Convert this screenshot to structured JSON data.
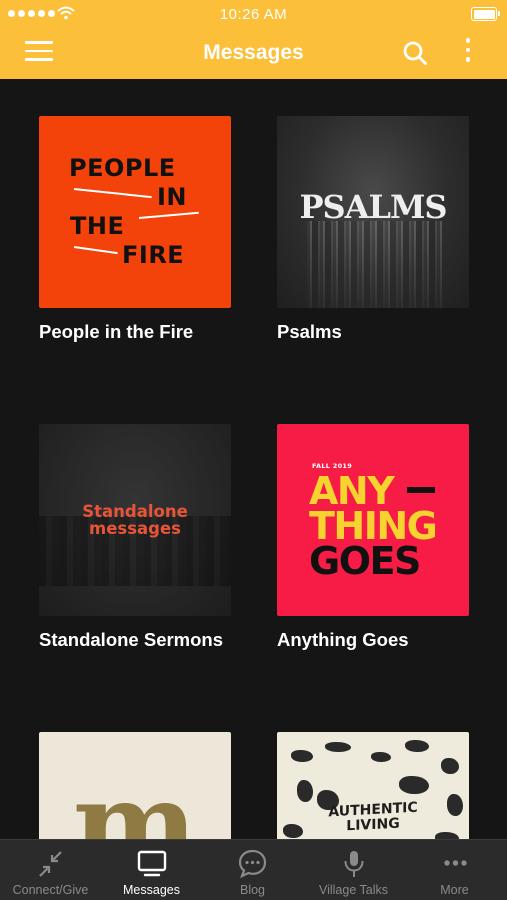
{
  "status_bar": {
    "time": "10:26 AM"
  },
  "header": {
    "title": "Messages"
  },
  "series": [
    {
      "title": "People in the Fire",
      "art_lines": [
        "PEOPLE",
        "IN",
        "THE",
        "FIRE"
      ]
    },
    {
      "title": "Psalms",
      "art_text": "PSALMS"
    },
    {
      "title": "Standalone Sermons",
      "art_lines": [
        "Standalone",
        "messages"
      ]
    },
    {
      "title": "Anything Goes",
      "art_kicker": "FALL 2019",
      "art_lines": [
        "ANY",
        "THING",
        "GOES"
      ]
    },
    {
      "title": "",
      "art_text": "m"
    },
    {
      "title": "",
      "art_lines": [
        "AUTHENTIC",
        "LIVING"
      ]
    }
  ],
  "tabs": [
    {
      "label": "Connect/Give",
      "icon": "compress-arrows-icon",
      "active": false
    },
    {
      "label": "Messages",
      "icon": "monitor-icon",
      "active": true
    },
    {
      "label": "Blog",
      "icon": "chat-bubble-icon",
      "active": false
    },
    {
      "label": "Village Talks",
      "icon": "microphone-icon",
      "active": false
    },
    {
      "label": "More",
      "icon": "ellipsis-icon",
      "active": false
    }
  ],
  "colors": {
    "header": "#fcbf3a",
    "background": "#151515",
    "tabbar": "#2b2b2b",
    "tab_active": "#ffffff",
    "tab_inactive": "#8a8a8a"
  }
}
